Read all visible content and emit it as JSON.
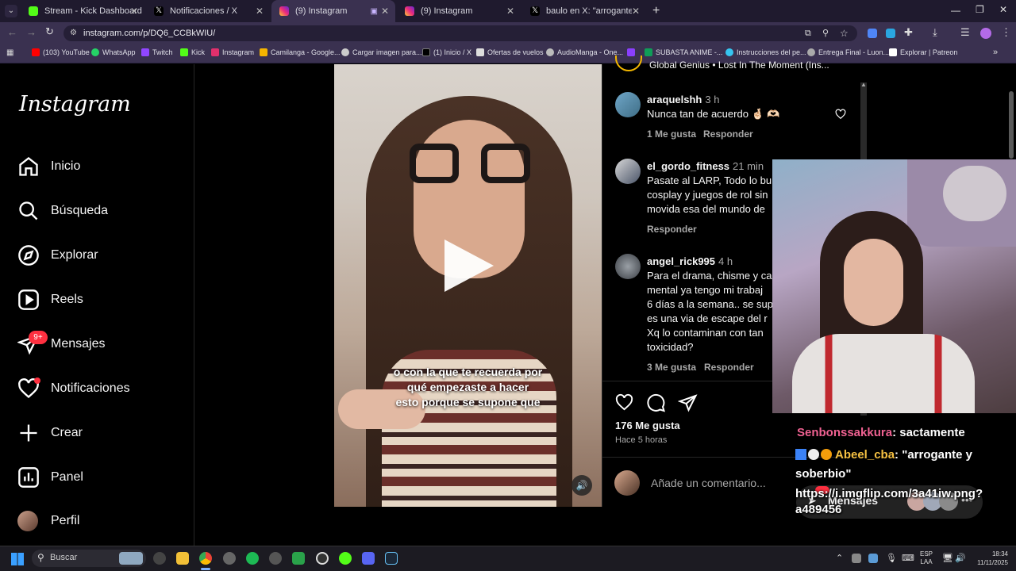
{
  "browser": {
    "tabs": [
      {
        "label": "Stream - Kick Dashboard",
        "color": "#53fc18"
      },
      {
        "label": "Notificaciones / X",
        "color": "#ffffff"
      },
      {
        "label": "(9) Instagram",
        "color": "#e1306c"
      },
      {
        "label": "(9) Instagram",
        "color": "#e1306c"
      },
      {
        "label": "baulo en X: \"arrogante y soberbio\"",
        "color": "#ffffff"
      }
    ],
    "url": "instagram.com/p/DQ6_CCBkWIU/",
    "bookmarks": [
      {
        "label": "(103) YouTube",
        "color": "#ff0000"
      },
      {
        "label": "WhatsApp",
        "color": "#25d366"
      },
      {
        "label": "Twitch",
        "color": "#9146ff"
      },
      {
        "label": "Kick",
        "color": "#53fc18"
      },
      {
        "label": "Instagram",
        "color": "#e1306c"
      },
      {
        "label": "Camilanga - Google...",
        "color": "#f4b400"
      },
      {
        "label": "Cargar imagen para...",
        "color": "#cccccc"
      },
      {
        "label": "(1) Inicio / X",
        "color": "#ffffff"
      },
      {
        "label": "Ofertas de vuelos",
        "color": "#dddddd"
      },
      {
        "label": "AudioManga - One...",
        "color": "#bbbbbb"
      },
      {
        "label": "",
        "color": "#8a3ffc"
      },
      {
        "label": "SUBASTA ANIME -...",
        "color": "#0f9d58"
      },
      {
        "label": "Instrucciones del pe...",
        "color": "#36c5f0"
      },
      {
        "label": "Entrega Final - Luon...",
        "color": "#aaaaaa"
      },
      {
        "label": "Explorar | Patreon",
        "color": "#ffffff"
      }
    ]
  },
  "instagram": {
    "logo": "Instagram",
    "nav": [
      {
        "label": "Inicio",
        "icon": "home-icon"
      },
      {
        "label": "Búsqueda",
        "icon": "search-icon"
      },
      {
        "label": "Explorar",
        "icon": "compass-icon"
      },
      {
        "label": "Reels",
        "icon": "reels-icon"
      },
      {
        "label": "Mensajes",
        "icon": "messenger-icon",
        "badge": "9+"
      },
      {
        "label": "Notificaciones",
        "icon": "heart-icon"
      },
      {
        "label": "Crear",
        "icon": "plus-icon"
      },
      {
        "label": "Panel",
        "icon": "chart-icon"
      },
      {
        "label": "Perfil",
        "icon": "avatar"
      }
    ],
    "video_caption": [
      "o con la que te recuerda por",
      "qué empezaste a hacer",
      "esto porque se supone que"
    ],
    "music_line": "Global Genius • Lost In The Moment (Ins...",
    "comments": [
      {
        "user": "araquelshh",
        "time": "3 h",
        "lines": [
          "Nunca tan de acuerdo 🤞🏻 🫶🏻"
        ],
        "likes": "1 Me gusta",
        "reply": "Responder"
      },
      {
        "user": "el_gordo_fitness",
        "time": "21 min",
        "lines": [
          "Pasate al LARP, Todo lo bu",
          "cosplay y juegos de rol sin",
          "movida esa del mundo de"
        ],
        "likes": "",
        "reply": "Responder"
      },
      {
        "user": "angel_rick995",
        "time": "4 h",
        "lines": [
          "Para el drama, chisme y ca",
          "mental ya tengo mi trabaj",
          "6 días a la semana.. se sup",
          "es una via de escape del r",
          "Xq lo contaminan con tan",
          "toxicidad?"
        ],
        "likes": "3 Me gusta",
        "reply": "Responder"
      }
    ],
    "likes_total": "176 Me gusta",
    "posted": "Hace 5 horas",
    "comment_placeholder": "Añade un comentario..."
  },
  "stream_chat": [
    {
      "user": "Senbonssakkura",
      "user_color": "#f06292",
      "text": ": sactamente"
    },
    {
      "user": "Abeel_cba",
      "user_color": "#f6c142",
      "text": ": \"arrogante y"
    },
    {
      "user": "",
      "user_color": "#ffffff",
      "text": "soberbio\""
    },
    {
      "user": "",
      "user_color": "#ffffff",
      "text": "https://i.imgflip.com/3a41iw.png?"
    },
    {
      "user": "",
      "user_color": "#ffffff",
      "text": "a489456"
    }
  ],
  "messages_pill": "Mensajes",
  "taskbar": {
    "search": "Buscar",
    "lang": "ESP",
    "region": "LAA",
    "time": "18:34",
    "date": "11/11/2025"
  }
}
